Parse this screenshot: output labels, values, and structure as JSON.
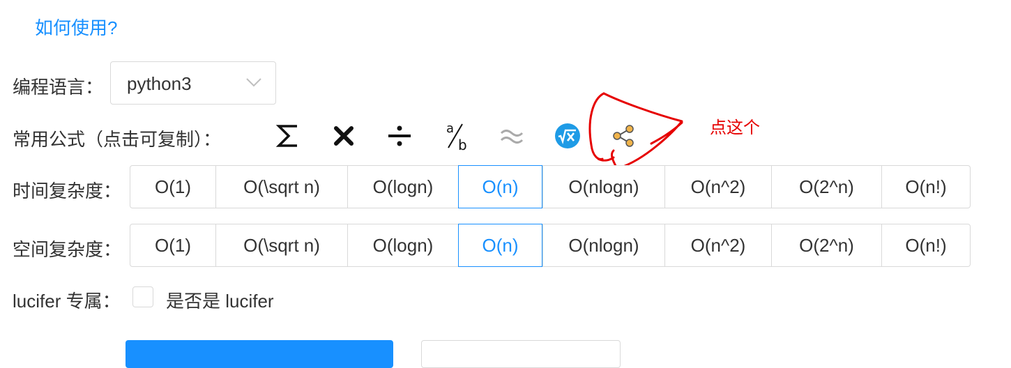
{
  "help": {
    "label": "如何使用?"
  },
  "language": {
    "label": "编程语言：",
    "value": "python3"
  },
  "formulas": {
    "label": "常用公式（点击可复制）：",
    "icons": [
      "sigma-icon",
      "multiply-icon",
      "divide-icon",
      "fraction-icon",
      "approx-icon",
      "sqrt-icon",
      "share-icon"
    ]
  },
  "time_complexity": {
    "label": "时间复杂度：",
    "options": [
      "O(1)",
      "O(\\sqrt n)",
      "O(logn)",
      "O(n)",
      "O(nlogn)",
      "O(n^2)",
      "O(2^n)",
      "O(n!)"
    ],
    "selected": "O(n)"
  },
  "space_complexity": {
    "label": "空间复杂度：",
    "options": [
      "O(1)",
      "O(\\sqrt n)",
      "O(logn)",
      "O(n)",
      "O(nlogn)",
      "O(n^2)",
      "O(2^n)",
      "O(n!)"
    ],
    "selected": "O(n)"
  },
  "lucifer": {
    "label": "lucifer 专属：",
    "checkbox_label": "是否是 lucifer",
    "checked": false
  },
  "annotation": {
    "text": "点这个",
    "color": "#e60000"
  },
  "colors": {
    "accent": "#1890ff",
    "text": "#333333",
    "border": "#d9d9d9"
  }
}
